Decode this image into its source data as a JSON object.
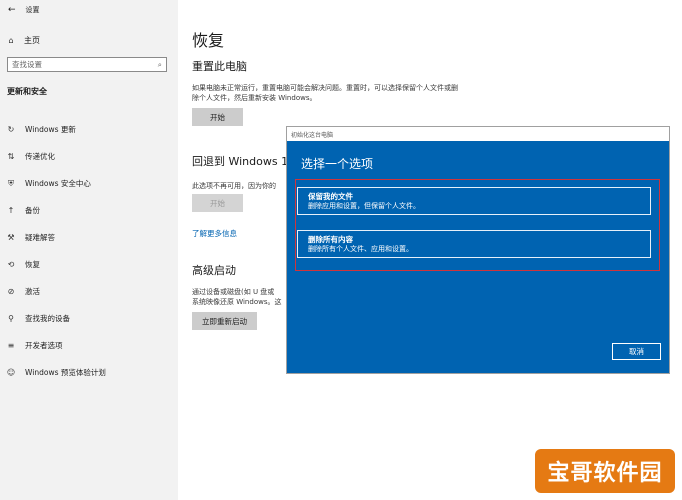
{
  "window": {
    "title": "设置"
  },
  "sidebar": {
    "home_label": "主页",
    "search_placeholder": "查找设置",
    "section_title": "更新和安全",
    "items": [
      {
        "label": "Windows 更新",
        "icon": "refresh-icon"
      },
      {
        "label": "传递优化",
        "icon": "delivery-optimization-icon"
      },
      {
        "label": "Windows 安全中心",
        "icon": "shield-icon"
      },
      {
        "label": "备份",
        "icon": "backup-icon"
      },
      {
        "label": "疑难解答",
        "icon": "wrench-icon"
      },
      {
        "label": "恢复",
        "icon": "recovery-icon"
      },
      {
        "label": "激活",
        "icon": "activation-icon"
      },
      {
        "label": "查找我的设备",
        "icon": "person-location-icon"
      },
      {
        "label": "开发者选项",
        "icon": "developer-icon"
      },
      {
        "label": "Windows 预览体验计划",
        "icon": "insider-icon"
      }
    ]
  },
  "main": {
    "title": "恢复",
    "reset": {
      "heading": "重置此电脑",
      "description": "如果电脑未正常运行，重置电脑可能会解决问题。重置时，可以选择保留个人文件或删除个人文件，然后重新安装 Windows。",
      "button": "开始"
    },
    "go_back": {
      "heading": "回退到 Windows 10",
      "description": "此选项不再可用，因为你的",
      "button": "开始",
      "link": "了解更多信息"
    },
    "advanced": {
      "heading": "高级启动",
      "description_line1": "通过设备或磁盘(如 U 盘或",
      "description_line2": "系统映像还原 Windows。这",
      "button": "立即重新启动"
    }
  },
  "dialog": {
    "title": "初始化这台电脑",
    "heading": "选择一个选项",
    "options": [
      {
        "title": "保留我的文件",
        "description": "删除应用和设置，但保留个人文件。"
      },
      {
        "title": "删除所有内容",
        "description": "删除所有个人文件、应用和设置。"
      }
    ],
    "cancel": "取消"
  },
  "watermark": {
    "text": "宝哥软件园"
  },
  "colors": {
    "dialog_bg": "#0063b1",
    "highlight": "#d0343b",
    "link": "#0063b1",
    "watermark_bg": "#e57a13"
  }
}
